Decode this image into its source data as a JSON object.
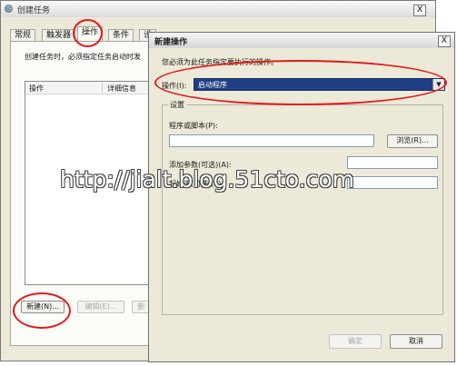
{
  "outer_window": {
    "title": "创建任务",
    "app_icon": "clock-icon",
    "close_glyph": "X",
    "tabs": [
      {
        "label": "常规"
      },
      {
        "label": "触发器"
      },
      {
        "label": "操作"
      },
      {
        "label": "条件"
      },
      {
        "label": "设"
      }
    ],
    "active_tab": "操作",
    "description": "创建任务时，必须指定任务启动时发",
    "list_headers": [
      "操作",
      "详细信息"
    ],
    "buttons": {
      "new": "新建(N)...",
      "edit": "编辑(E)...",
      "delete": "删"
    }
  },
  "dialog": {
    "title": "新建操作",
    "close_glyph": "X",
    "instruction": "您必须为此任务指定要执行的操作。",
    "action_label": "操作(I):",
    "action_value": "启动程序",
    "settings_legend": "设置",
    "program_label": "程序或脚本(P):",
    "program_value": "",
    "browse_button": "浏览(R)...",
    "args_label": "添加参数(可选)(A):",
    "args_value": "",
    "startin_label": "起始于(可选)(T):",
    "startin_value": "",
    "ok_button": "确定",
    "cancel_button": "取消"
  },
  "watermark": "http://jialt.blog.51cto.com",
  "colors": {
    "annotation_red": "#e21b1b",
    "selection_blue": "#203e86"
  }
}
